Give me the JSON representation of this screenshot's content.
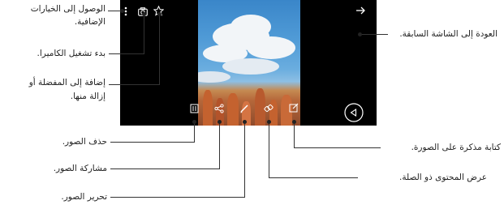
{
  "labels": {
    "more_options_line1": "الوصول إلى الخيارات",
    "more_options_line2": "الإضافية.",
    "camera": "بدء تشغيل الكاميرا.",
    "favorite_line1": "إضافة إلى المفضلة أو",
    "favorite_line2": "إزالة منها.",
    "delete": "حذف الصور.",
    "share": "مشاركة الصور.",
    "edit": "تحرير الصور.",
    "back": "العودة إلى الشاشة السابقة.",
    "memo": "كتابة مذكرة على الصورة.",
    "related": "عرض المحتوى ذو الصلة."
  },
  "icons": [
    "more-options-icon",
    "camera-icon",
    "star-icon",
    "back-arrow-icon",
    "delete-icon",
    "share-icon",
    "edit-icon",
    "related-content-icon",
    "memo-icon",
    "nav-back-icon"
  ],
  "colors": {
    "screen": "#000000",
    "icon": "#ffffff",
    "leader": "#333333"
  }
}
